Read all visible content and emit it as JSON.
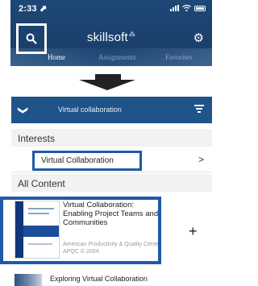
{
  "top_screen": {
    "status": {
      "time": "2:33 ⬈"
    },
    "brand": {
      "name": "skillsoft",
      "mark": "⁂"
    },
    "icons": {
      "search": "search-icon",
      "settings": "gear-icon"
    },
    "tabs": [
      {
        "label": "Home",
        "active": true
      },
      {
        "label": "Assignments",
        "active": false
      },
      {
        "label": "Favorites",
        "active": false
      }
    ]
  },
  "bottom_screen": {
    "header": {
      "back_glyph": "❯",
      "title": "Virtual collaboration"
    },
    "sections": {
      "interests": "Interests",
      "all_content": "All Content"
    },
    "interest_row": {
      "label": "Virtual Collaboration",
      "chevron": ">"
    },
    "card": {
      "title": "Virtual Collaboration: Enabling Project Teams and Communities",
      "publisher": "American Productivity & Quality Center",
      "copyright": "APQC © 2004",
      "add_label": "+"
    },
    "next_item": {
      "title": "Exploring Virtual Collaboration"
    }
  },
  "colors": {
    "header_blue": "#1f548a",
    "highlight_blue": "#1e5aa8",
    "nav_dark": "#1d4877"
  }
}
